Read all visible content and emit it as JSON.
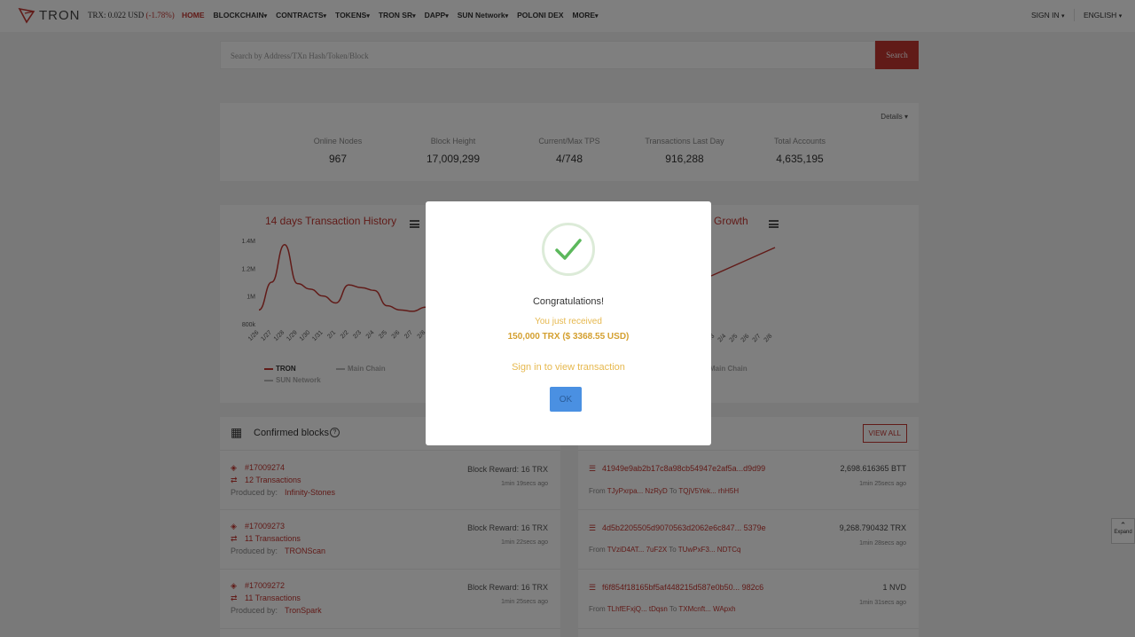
{
  "nav": {
    "logo": "TRON",
    "price_label": "TRX: 0.022 USD",
    "price_change": "(-1.78%)",
    "items": [
      {
        "label": "HOME",
        "caret": false
      },
      {
        "label": "BLOCKCHAIN",
        "caret": true
      },
      {
        "label": "CONTRACTS",
        "caret": true
      },
      {
        "label": "TOKENS",
        "caret": true
      },
      {
        "label": "TRON SR",
        "caret": true
      },
      {
        "label": "DAPP",
        "caret": true
      },
      {
        "label": "SUN Network",
        "caret": true
      },
      {
        "label": "POLONI DEX",
        "caret": false
      },
      {
        "label": "MORE",
        "caret": true
      }
    ],
    "signin": "SIGN IN",
    "language": "ENGLISH"
  },
  "search": {
    "placeholder": "Search by Address/TXn Hash/Token/Block",
    "button": "Search"
  },
  "stats": {
    "details": "Details",
    "items": [
      {
        "label": "Online Nodes",
        "value": "967"
      },
      {
        "label": "Block Height",
        "value": "17,009,299"
      },
      {
        "label": "Current/Max TPS",
        "value": "4/748"
      },
      {
        "label": "Transactions Last Day",
        "value": "916,288"
      },
      {
        "label": "Total Accounts",
        "value": "4,635,195"
      }
    ]
  },
  "charts": {
    "left_title": "14 days Transaction History",
    "right_title_visible": "Growth",
    "legend": [
      "TRON",
      "Main Chain",
      "SUN Network"
    ],
    "legend_right": "Main Chain"
  },
  "chart_data": {
    "type": "line",
    "title": "14 days Transaction History",
    "categories": [
      "1/26",
      "1/27",
      "1/28",
      "1/29",
      "1/30",
      "1/31",
      "2/1",
      "2/2",
      "2/3",
      "2/4",
      "2/5",
      "2/6",
      "2/7",
      "2/8"
    ],
    "y_ticks": [
      "1.4M",
      "1.2M",
      "1M",
      "800k"
    ],
    "ylim": [
      800000,
      1400000
    ],
    "series": [
      {
        "name": "TRON",
        "values": [
          900000,
          1100000,
          1370000,
          1090000,
          1050000,
          1000000,
          950000,
          1080000,
          1060000,
          1040000,
          930000,
          900000,
          890000,
          920000
        ]
      }
    ],
    "legend_placement": "bottom"
  },
  "right_chart": {
    "x_labels": [
      "2/3",
      "2/4",
      "2/5",
      "2/6",
      "2/7",
      "2/8"
    ]
  },
  "blocks": {
    "title": "Confirmed blocks",
    "items": [
      {
        "number": "#17009274",
        "tx": "12 Transactions",
        "produced_label": "Produced by:",
        "producer": "Infinity-Stones",
        "reward": "Block Reward: 16 TRX",
        "time": "1min 19secs ago"
      },
      {
        "number": "#17009273",
        "tx": "11 Transactions",
        "produced_label": "Produced by:",
        "producer": "TRONScan",
        "reward": "Block Reward: 16 TRX",
        "time": "1min 22secs ago"
      },
      {
        "number": "#17009272",
        "tx": "11 Transactions",
        "produced_label": "Produced by:",
        "producer": "TronSpark",
        "reward": "Block Reward: 16 TRX",
        "time": "1min 25secs ago"
      }
    ]
  },
  "transfers": {
    "view_all": "VIEW ALL",
    "items": [
      {
        "hash": "41949e9ab2b17c8a98cb54947e2af5a...d9d99",
        "amount": "2,698.616365 BTT",
        "from_label": "From",
        "from": "TJyPxrpa... NzRyD",
        "to_label": "To",
        "to": "TQjV5Yek... rhH5H",
        "time": "1min 25secs ago"
      },
      {
        "hash": "4d5b2205505d9070563d2062e6c847... 5379e",
        "amount": "9,268.790432 TRX",
        "from_label": "From",
        "from": "TVziD4AT... 7uF2X",
        "to_label": "To",
        "to": "TUwPxF3... NDTCq",
        "time": "1min 28secs ago"
      },
      {
        "hash": "f6f854f18165bf5af448215d587e0b50... 982c6",
        "amount": "1 NVD",
        "from_label": "From",
        "from": "TLhfEFxjQ... tDqsn",
        "to_label": "To",
        "to": "TXMcnft... WApxh",
        "time": "1min 31secs ago"
      }
    ]
  },
  "modal": {
    "title": "Congratulations!",
    "subtitle": "You just received",
    "amount": "150,000 TRX ($ 3368.55 USD)",
    "link": "Sign in to view transaction",
    "ok": "OK"
  },
  "expand": "Expand"
}
